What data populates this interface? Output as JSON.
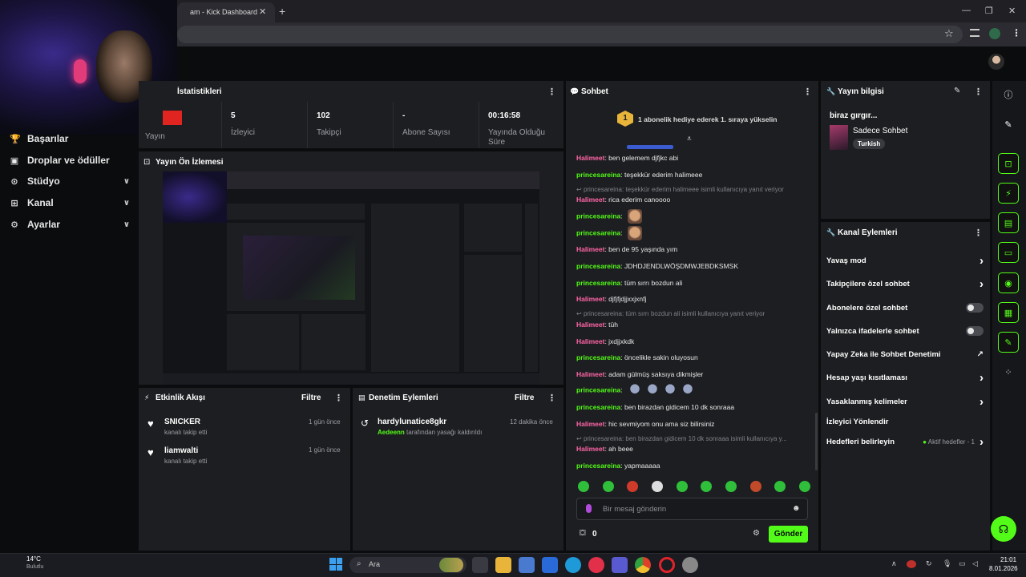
{
  "browser": {
    "tab_title": "am - Kick Dashboard",
    "tab_close": "✕",
    "new_tab": "+",
    "min": "—",
    "max": "❐",
    "close": "✕",
    "star": "☆"
  },
  "sidebar": {
    "items": [
      {
        "icon": "🏆",
        "label": "Başarılar",
        "chevron": ""
      },
      {
        "icon": "▣",
        "label": "Droplar ve ödüller",
        "chevron": ""
      },
      {
        "icon": "⊙",
        "label": "Stüdyo",
        "chevron": "∨"
      },
      {
        "icon": "⊞",
        "label": "Kanal",
        "chevron": "∨"
      },
      {
        "icon": "⚙",
        "label": "Ayarlar",
        "chevron": "∨"
      }
    ]
  },
  "stats": {
    "title": "İstatistikleri",
    "menu": "⋮",
    "items": [
      {
        "value": "",
        "label": "Yayın"
      },
      {
        "value": "5",
        "label": "İzleyici"
      },
      {
        "value": "102",
        "label": "Takipçi"
      },
      {
        "value": "-",
        "label": "Abone Sayısı"
      },
      {
        "value": "00:16:58",
        "label": "Yayında Olduğu Süre"
      }
    ]
  },
  "preview": {
    "title": "Yayın Ön İzlemesi"
  },
  "activity": {
    "title": "Etkinlik Akışı",
    "filter": "Filtre",
    "menu": "⋮",
    "items": [
      {
        "name": "SNICKER",
        "sub": "kanalı takip etti",
        "time": "1 gün önce"
      },
      {
        "name": "liamwalti",
        "sub": "kanalı takip etti",
        "time": "1 gün önce"
      }
    ]
  },
  "moderation": {
    "title": "Denetim Eylemleri",
    "filter": "Filtre",
    "menu": "⋮",
    "items": [
      {
        "name": "hardylunatice8gkr",
        "actor": "Aedeenn",
        "sub": " tarafından yasağı kaldırıldı",
        "time": "12 dakika önce"
      }
    ]
  },
  "chat": {
    "title": "Sohbet",
    "menu": "⋮",
    "banner_rank": "1",
    "banner_text": "1 abonelik hediye ederek 1. sıraya yükselin",
    "lines": [
      {
        "kind": "msg",
        "user": "Halimeet",
        "color": "pink",
        "text": "ben gelemem djfjkc abi"
      },
      {
        "kind": "msg",
        "user": "princesareina",
        "color": "green",
        "text": "teşekkür ederim halimeee"
      },
      {
        "kind": "reply",
        "text": "princesareina: teşekkür ederim halimeee isimli kullanıcıya yanıt veriyor"
      },
      {
        "kind": "msg",
        "user": "Halimeet",
        "color": "pink",
        "text": "rica ederim canoooo"
      },
      {
        "kind": "emote",
        "user": "princesareina",
        "color": "green",
        "text": ""
      },
      {
        "kind": "emote",
        "user": "princesareina",
        "color": "green",
        "text": ""
      },
      {
        "kind": "msg",
        "user": "Halimeet",
        "color": "pink",
        "text": "ben de 95 yaşında yım"
      },
      {
        "kind": "msg",
        "user": "princesareina",
        "color": "green",
        "text": "JDHDJENDLWÖŞDMWJEBDKSMSK"
      },
      {
        "kind": "msg",
        "user": "princesareina",
        "color": "green",
        "text": "tüm sırrı bozdun ali"
      },
      {
        "kind": "msg",
        "user": "Halimeet",
        "color": "pink",
        "text": "djfjfjdjjxxjxnfj"
      },
      {
        "kind": "reply",
        "text": "princesareina: tüm sırrı bozdun ali isimli kullanıcıya yanıt veriyor"
      },
      {
        "kind": "msg",
        "user": "Halimeet",
        "color": "pink",
        "text": "tüh"
      },
      {
        "kind": "msg",
        "user": "Halimeet",
        "color": "pink",
        "text": "jxdjjxkdk"
      },
      {
        "kind": "msg",
        "user": "princesareina",
        "color": "green",
        "text": "öncelikle sakin oluyosun"
      },
      {
        "kind": "msg",
        "user": "Halimeet",
        "color": "pink",
        "text": "adam gülmüş saksıya dikmişler"
      },
      {
        "kind": "emote4",
        "user": "princesareina",
        "color": "green",
        "text": ""
      },
      {
        "kind": "msg",
        "user": "princesareina",
        "color": "green",
        "text": "ben birazdan gidicem 10 dk sonraaa"
      },
      {
        "kind": "msg",
        "user": "Halimeet",
        "color": "pink",
        "text": "hic sevmiyom onu ama siz bilirsiniz"
      },
      {
        "kind": "reply",
        "text": "princesareina: ben birazdan gidicem 10 dk sonraaa isimli kullanıcıya y..."
      },
      {
        "kind": "msg",
        "user": "Halimeet",
        "color": "pink",
        "text": "ah beee"
      },
      {
        "kind": "msg",
        "user": "princesareina",
        "color": "green",
        "text": "yapmaaaaa"
      }
    ],
    "input_placeholder": "Bir mesaj gönderin",
    "points": "0",
    "send": "Gönder"
  },
  "stream_info": {
    "title": "Yayın bilgisi",
    "stream_title": "biraz gırgır...",
    "category": "Sadece Sohbet",
    "tag": "Turkish"
  },
  "channel_actions": {
    "title": "Kanal Eylemleri",
    "rows": [
      {
        "label": "Yavaş mod",
        "control": "chevron"
      },
      {
        "label": "Takipçilere özel sohbet",
        "control": "chevron"
      },
      {
        "label": "Abonelere özel sohbet",
        "control": "toggle"
      },
      {
        "label": "Yalnızca ifadelerle sohbet",
        "control": "toggle"
      },
      {
        "label": "Yapay Zeka ile Sohbet Denetimi",
        "control": "external"
      },
      {
        "label": "Hesap yaşı kısıtlaması",
        "control": "chevron"
      },
      {
        "label": "Yasaklanmış kelimeler",
        "control": "chevron"
      },
      {
        "label": "İzleyici Yönlendir",
        "control": "none"
      },
      {
        "label": "Hedefleri belirleyin",
        "control": "chevron",
        "extra": "Aktif hedefler - 1"
      }
    ]
  },
  "overlay": {
    "user": "princesareina",
    "text": "yapmaaaaa",
    "weather": "14°C",
    "weather_sub": "Bulutlu"
  },
  "taskbar": {
    "search": "Ara",
    "time": "21:01",
    "date": "8.01.2026"
  },
  "colors": {
    "accent": "#53fc18",
    "pink_user": "#ff66a8",
    "panel": "#1d1e21"
  }
}
